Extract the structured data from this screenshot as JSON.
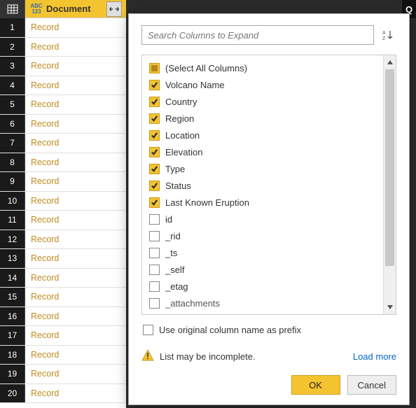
{
  "rightbar_letter": "Q",
  "grid": {
    "column_header": "Document",
    "type_hint_top": "ABC",
    "type_hint_bot": "123",
    "row_value": "Record",
    "row_count": 20
  },
  "popup": {
    "search_placeholder": "Search Columns to Expand",
    "select_all_label": "(Select All Columns)",
    "columns": [
      {
        "label": "Volcano Name",
        "checked": true
      },
      {
        "label": "Country",
        "checked": true
      },
      {
        "label": "Region",
        "checked": true
      },
      {
        "label": "Location",
        "checked": true
      },
      {
        "label": "Elevation",
        "checked": true
      },
      {
        "label": "Type",
        "checked": true
      },
      {
        "label": "Status",
        "checked": true
      },
      {
        "label": "Last Known Eruption",
        "checked": true
      },
      {
        "label": "id",
        "checked": false
      },
      {
        "label": "_rid",
        "checked": false
      },
      {
        "label": "_ts",
        "checked": false
      },
      {
        "label": "_self",
        "checked": false
      },
      {
        "label": "_etag",
        "checked": false
      },
      {
        "label": "_attachments",
        "checked": false
      }
    ],
    "prefix_label": "Use original column name as prefix",
    "prefix_checked": false,
    "warning_text": "List may be incomplete.",
    "load_more_label": "Load more",
    "ok_label": "OK",
    "cancel_label": "Cancel"
  }
}
